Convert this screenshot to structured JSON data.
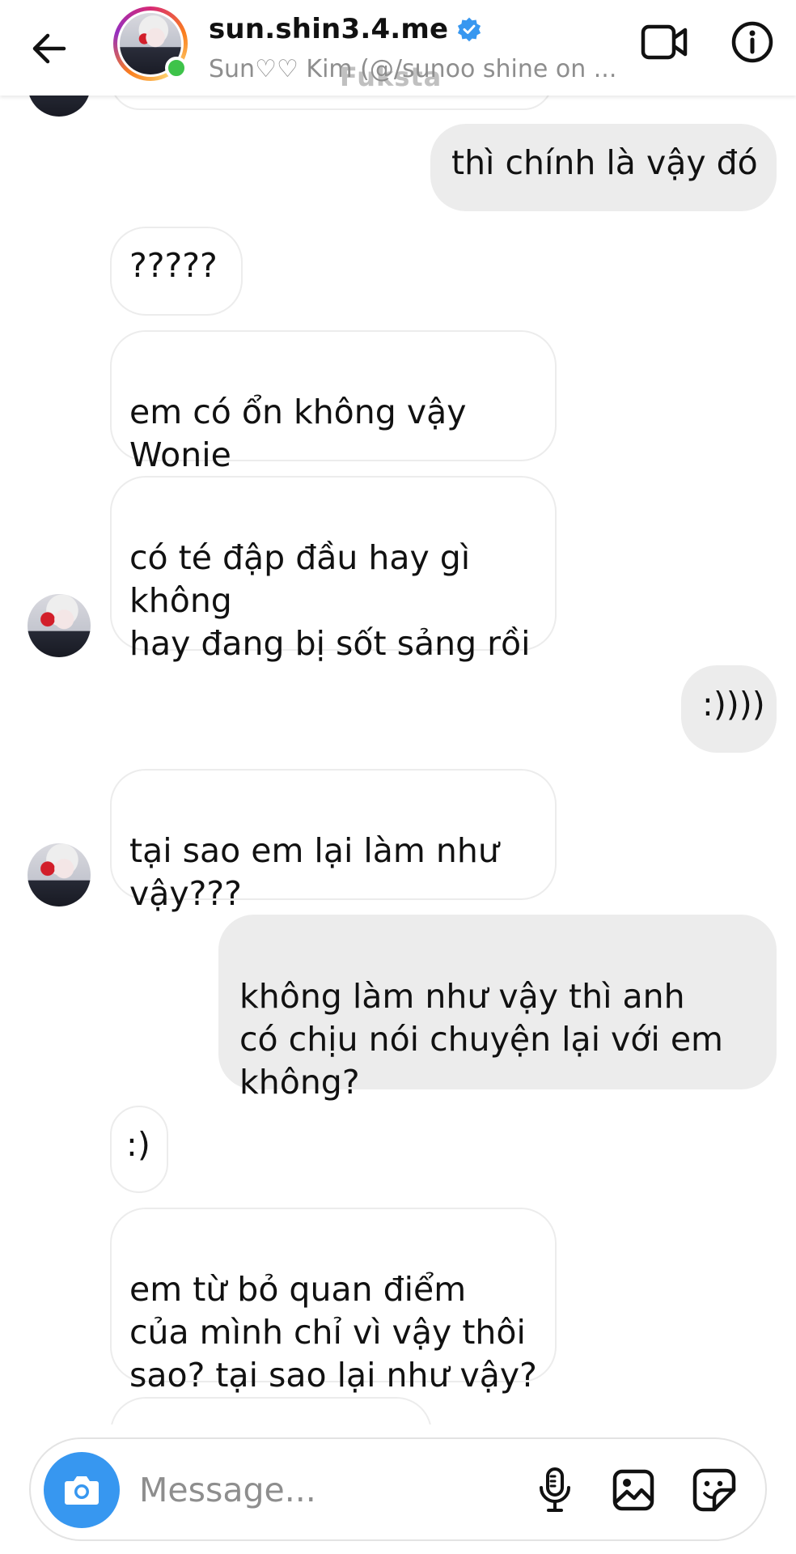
{
  "header": {
    "username": "sun.shin3.4.me",
    "verified_icon": "verified-badge-icon",
    "subtitle": "Sun♡♡ Kim (@/sunoo shine on ...",
    "watermark": "Fuksta",
    "back_icon": "arrow-left-icon",
    "video_icon": "video-call-icon",
    "info_icon": "info-icon",
    "online": true
  },
  "messages": [
    {
      "from": "them",
      "text": ""
    },
    {
      "from": "me",
      "text": "thì chính là vậy đó"
    },
    {
      "from": "them",
      "text": "?????"
    },
    {
      "from": "them",
      "text": "em có ổn không vậy\nWonie"
    },
    {
      "from": "them",
      "text": "có té đập đầu hay gì\nkhông\nhay đang bị sốt sảng rồi"
    },
    {
      "from": "me",
      "text": ":))))"
    },
    {
      "from": "them",
      "text": "tại sao em lại làm như\nvậy???"
    },
    {
      "from": "me",
      "text": "không làm như vậy thì anh\ncó chịu nói chuyện lại với em\nkhông?"
    },
    {
      "from": "them",
      "text": ":)"
    },
    {
      "from": "them",
      "text": "em từ bỏ quan điểm\ncủa mình chỉ vì vậy thôi\nsao? tại sao lại như vậy?"
    },
    {
      "from": "them",
      "text": ""
    }
  ],
  "composer": {
    "placeholder": "Message...",
    "value": "",
    "camera_icon": "camera-icon",
    "mic_icon": "microphone-icon",
    "gallery_icon": "image-gallery-icon",
    "sticker_icon": "sticker-icon"
  },
  "colors": {
    "accent_blue": "#3797f0",
    "outgoing_bubble": "#ececec",
    "incoming_border": "#ececec",
    "online_green": "#3ec34a",
    "subtitle_gray": "#8e8e8e"
  }
}
